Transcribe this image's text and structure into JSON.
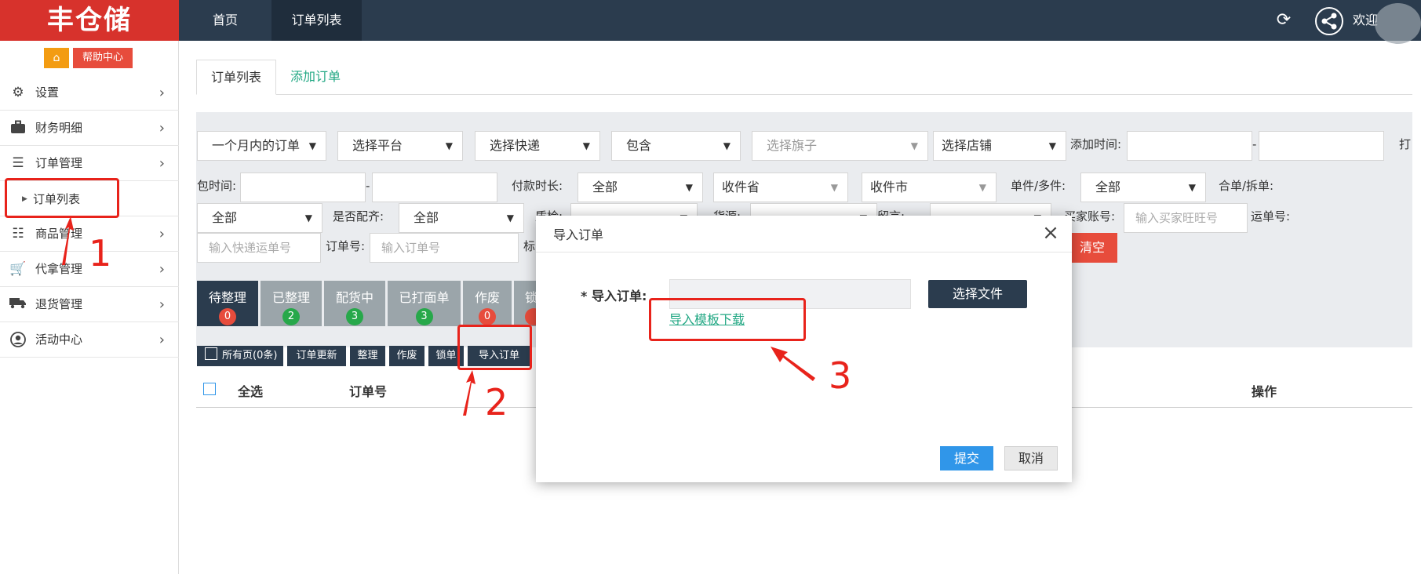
{
  "topbar": {
    "logo": "丰仓储",
    "tabs": [
      "首页",
      "订单列表"
    ],
    "welcome": "欢迎"
  },
  "sidebar": {
    "help_label": "帮助中心",
    "items": [
      {
        "label": "设置",
        "icon": "gear-icon"
      },
      {
        "label": "财务明细",
        "icon": "briefcase-icon"
      },
      {
        "label": "订单管理",
        "icon": "list-icon"
      },
      {
        "label": "订单列表",
        "icon": "triangle-right-icon"
      },
      {
        "label": "商品管理",
        "icon": "list-icon"
      },
      {
        "label": "代拿管理",
        "icon": "cart-icon"
      },
      {
        "label": "退货管理",
        "icon": "truck-icon"
      },
      {
        "label": "活动中心",
        "icon": "user-circle-icon"
      }
    ]
  },
  "content_tabs": [
    "订单列表",
    "添加订单"
  ],
  "filters": {
    "row1": {
      "period": "一个月内的订单",
      "platform": "选择平台",
      "express": "选择快递",
      "contains": "包含",
      "flag": "选择旗子",
      "shop": "选择店铺",
      "add_time_label": "添加时间:",
      "dash": "-",
      "print_label": "打"
    },
    "row2": {
      "pack_time_label": "包时间:",
      "dash": "-",
      "pay_duration_label": "付款时长:",
      "pay_duration_value": "全部",
      "province": "收件省",
      "city": "收件市",
      "single_multi_label": "单件/多件:",
      "single_multi_value": "全部",
      "merge_split_label": "合单/拆单:"
    },
    "row3": {
      "merge_split_value": "全部",
      "matched_label": "是否配齐:",
      "matched_value": "全部",
      "quality_label": "质检:",
      "source_label": "货源:",
      "message_label": "留言:",
      "buyer_label": "买家账号:",
      "buyer_placeholder": "输入买家旺旺号",
      "waybill_label": "运单号:"
    },
    "row4": {
      "express_no_placeholder": "输入快递运单号",
      "order_no_label": "订单号:",
      "order_no_placeholder": "输入订单号",
      "tag_label": "标",
      "clear_label": "清空"
    }
  },
  "status_tabs": [
    {
      "label": "待整理",
      "count": "0",
      "badge_color": "#e74c3c",
      "bg": "#2b3c4e"
    },
    {
      "label": "已整理",
      "count": "2",
      "badge_color": "#27a84a",
      "bg": "#9ba5aa"
    },
    {
      "label": "配货中",
      "count": "3",
      "badge_color": "#27a84a",
      "bg": "#9ba5aa"
    },
    {
      "label": "已打面单",
      "count": "3",
      "badge_color": "#27a84a",
      "bg": "#9ba5aa"
    },
    {
      "label": "作废",
      "count": "0",
      "badge_color": "#e74c3c",
      "bg": "#9ba5aa"
    },
    {
      "label": "锁",
      "count": "",
      "badge_color": "#e74c3c",
      "bg": "#9ba5aa"
    }
  ],
  "actions": [
    "所有页(0条)",
    "订单更新",
    "整理",
    "作废",
    "锁单",
    "导入订单"
  ],
  "table_headers": {
    "select_all": "全选",
    "order_no": "订单号",
    "operation": "操作"
  },
  "modal": {
    "title": "导入订单",
    "close": "×",
    "field_label": "* 导入订单:",
    "choose_file": "选择文件",
    "template_link": "导入模板下载",
    "submit": "提交",
    "cancel": "取消"
  },
  "annotations": {
    "step1": "1",
    "step2": "2",
    "step3": "3"
  }
}
